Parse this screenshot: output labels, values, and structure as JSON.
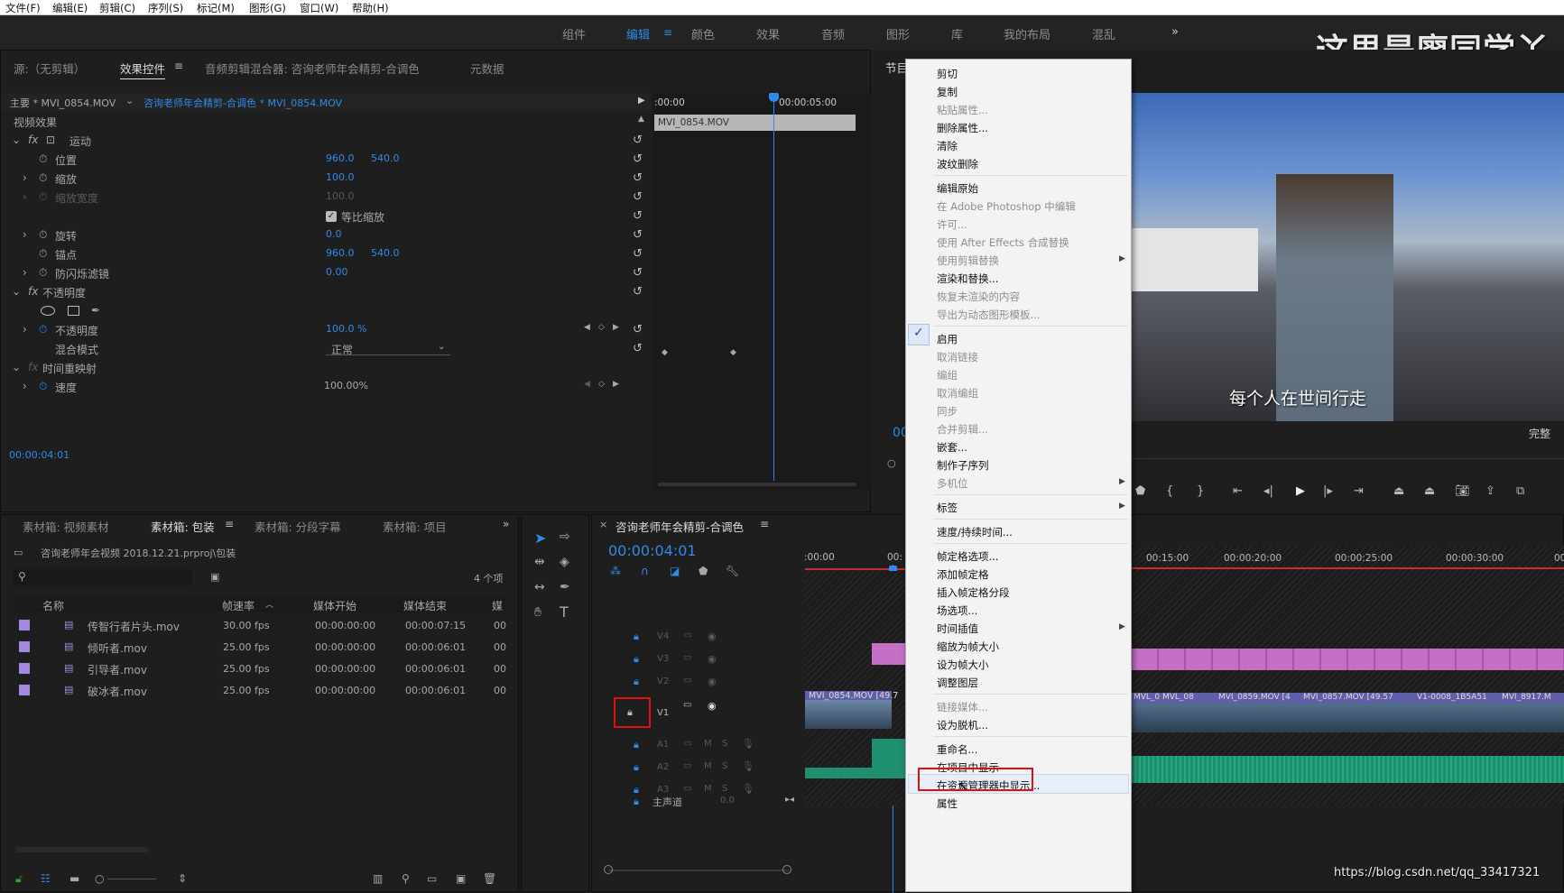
{
  "menu": [
    "文件(F)",
    "编辑(E)",
    "剪辑(C)",
    "序列(S)",
    "标记(M)",
    "图形(G)",
    "窗口(W)",
    "帮助(H)"
  ],
  "workspaces": [
    "组件",
    "编辑",
    "颜色",
    "效果",
    "音频",
    "图形",
    "库",
    "我的布局",
    "混乱"
  ],
  "workspace_more": "»",
  "watermark_top": "这里是廖同学丫",
  "effects_panel": {
    "tabs": [
      "源:（无剪辑）",
      "效果控件",
      "音频剪辑混合器: 咨询老师年会精剪-合调色",
      "元数据"
    ],
    "master_label": "主要 * MVI_0854.MOV",
    "sequence_label": "咨询老师年会精剪-合调色 * MVI_0854.MOV",
    "section_video": "视频效果",
    "motion": "运动",
    "position_label": "位置",
    "position_x": "960.0",
    "position_y": "540.0",
    "scale_label": "缩放",
    "scale_val": "100.0",
    "scale_width_label": "缩放宽度",
    "scale_width_val": "100.0",
    "uniform_label": "等比缩放",
    "rotation_label": "旋转",
    "rotation_val": "0.0",
    "anchor_label": "锚点",
    "anchor_x": "960.0",
    "anchor_y": "540.0",
    "flicker_label": "防闪烁滤镜",
    "flicker_val": "0.00",
    "opacity_group": "不透明度",
    "opacity_label": "不透明度",
    "opacity_val": "100.0 %",
    "blend_label": "混合模式",
    "blend_val": "正常",
    "time_remap": "时间重映射",
    "speed_label": "速度",
    "speed_val": "100.00%",
    "mini_time_start": ":00:00",
    "mini_time_end": "00:00:05:00",
    "mini_clip": "MVI_0854.MOV",
    "current_time": "00:00:04:01"
  },
  "project_panel": {
    "tabs": [
      "素材箱: 视频素材",
      "素材箱: 包装",
      "素材箱: 分段字幕",
      "素材箱: 项目"
    ],
    "path": "咨询老师年会视频 2018.12.21.prproj\\包装",
    "count": "4 个项",
    "columns": [
      "名称",
      "帧速率",
      "媒体开始",
      "媒体结束",
      "媒"
    ],
    "rows": [
      [
        "传智行者片头.mov",
        "30.00 fps",
        "00:00:00:00",
        "00:00:07:15",
        "00"
      ],
      [
        "倾听者.mov",
        "25.00 fps",
        "00:00:00:00",
        "00:00:06:01",
        "00"
      ],
      [
        "引导者.mov",
        "25.00 fps",
        "00:00:00:00",
        "00:00:06:01",
        "00"
      ],
      [
        "破冰者.mov",
        "25.00 fps",
        "00:00:00:00",
        "00:00:06:01",
        "00"
      ]
    ]
  },
  "timeline": {
    "title": "咨询老师年会精剪-合调色",
    "timecode": "00:00:04:01",
    "ruler": [
      ":00:00",
      "00:",
      "00:15:00",
      "00:00:20:00",
      "00:00:25:00",
      "00:00:30:00",
      "00:"
    ],
    "tracks": [
      "V4",
      "V3",
      "V2",
      "V1",
      "A1",
      "A2",
      "A3"
    ],
    "master": "主声道",
    "master_val": "0.0",
    "clips_v1": [
      "MVI_0854.MOV [49.7",
      "MVL_0",
      "MVL_08",
      "MVI_0859.MOV [4",
      "MVI_0857.MOV [49.57",
      "V1-0008_1B5A51",
      "MVI_8917.M"
    ]
  },
  "program": {
    "label": "节目",
    "subtitle": "每个人在世间行走",
    "quality": "完整",
    "time_partial": "00"
  },
  "context_menu": {
    "items": [
      {
        "label": "剪切",
        "enabled": true
      },
      {
        "label": "复制",
        "enabled": true
      },
      {
        "label": "粘贴属性...",
        "enabled": false
      },
      {
        "label": "删除属性...",
        "enabled": true
      },
      {
        "label": "清除",
        "enabled": true
      },
      {
        "label": "波纹删除",
        "enabled": true
      },
      {
        "label": "编辑原始",
        "enabled": true
      },
      {
        "label": "在 Adobe Photoshop 中编辑",
        "enabled": false
      },
      {
        "label": "许可...",
        "enabled": false
      },
      {
        "label": "使用 After Effects 合成替换",
        "enabled": false
      },
      {
        "label": "使用剪辑替换",
        "enabled": false
      },
      {
        "label": "渲染和替换...",
        "enabled": true
      },
      {
        "label": "恢复未渲染的内容",
        "enabled": false
      },
      {
        "label": "导出为动态图形模板...",
        "enabled": false
      },
      {
        "label": "启用",
        "enabled": true
      },
      {
        "label": "取消链接",
        "enabled": false
      },
      {
        "label": "编组",
        "enabled": false
      },
      {
        "label": "取消编组",
        "enabled": false
      },
      {
        "label": "同步",
        "enabled": false
      },
      {
        "label": "合并剪辑...",
        "enabled": false
      },
      {
        "label": "嵌套...",
        "enabled": true
      },
      {
        "label": "制作子序列",
        "enabled": true
      },
      {
        "label": "多机位",
        "enabled": false
      },
      {
        "label": "标签",
        "enabled": true
      },
      {
        "label": "速度/持续时间...",
        "enabled": true
      },
      {
        "label": "帧定格选项...",
        "enabled": true
      },
      {
        "label": "添加帧定格",
        "enabled": true
      },
      {
        "label": "插入帧定格分段",
        "enabled": true
      },
      {
        "label": "场选项...",
        "enabled": true
      },
      {
        "label": "时间插值",
        "enabled": true
      },
      {
        "label": "缩放为帧大小",
        "enabled": true
      },
      {
        "label": "设为帧大小",
        "enabled": true
      },
      {
        "label": "调整图层",
        "enabled": true
      },
      {
        "label": "链接媒体...",
        "enabled": false
      },
      {
        "label": "设为脱机...",
        "enabled": true
      },
      {
        "label": "重命名...",
        "enabled": true
      },
      {
        "label": "在项目中显示",
        "enabled": true
      },
      {
        "label": "在资源管理器中显示...",
        "enabled": true
      },
      {
        "label": "属性",
        "enabled": true
      }
    ],
    "checkmark": "✓"
  },
  "watermark_url": "https://blog.csdn.net/qq_33417321",
  "colors": {
    "accent": "#2d8ceb",
    "highlight_box": "#e01010",
    "video_clip": "#c66fc6",
    "audio_clip": "#1e8f6f",
    "v1_clip": "#6a6aa8"
  }
}
